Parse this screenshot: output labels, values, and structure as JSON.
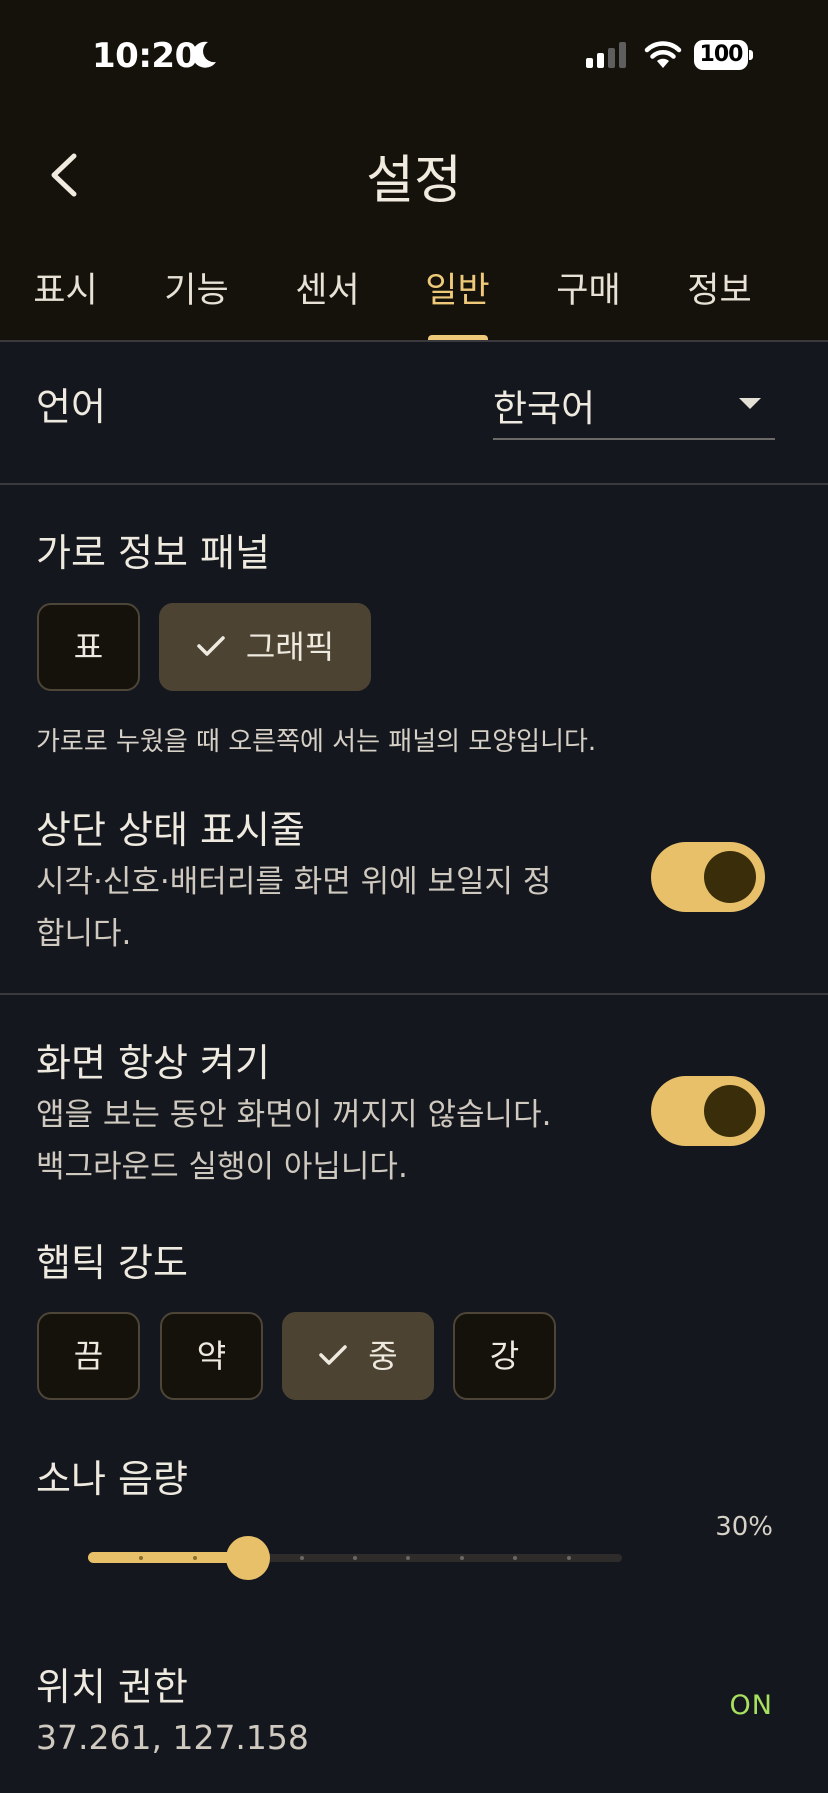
{
  "status_bar": {
    "time": "10:20",
    "battery": "100"
  },
  "header": {
    "title": "설정"
  },
  "tabs": [
    {
      "label": "표시"
    },
    {
      "label": "기능"
    },
    {
      "label": "센서"
    },
    {
      "label": "일반",
      "active": true
    },
    {
      "label": "구매"
    },
    {
      "label": "정보"
    }
  ],
  "language": {
    "label": "언어",
    "value": "한국어"
  },
  "landscape_panel": {
    "label": "가로 정보 패널",
    "options": [
      "표",
      "그래픽"
    ],
    "selected": "그래픽",
    "description": "가로로 누웠을 때 오른쪽에 서는 패널의 모양입니다."
  },
  "status_bar_setting": {
    "label": "상단 상태 표시줄",
    "description_line1": "시각·신호·배터리를 화면 위에 보일지 정",
    "description_line2": "합니다.",
    "enabled": true
  },
  "keep_screen_on": {
    "label": "화면 항상 켜기",
    "description_line1": "앱을 보는 동안 화면이 꺼지지 않습니다.",
    "description_line2": "백그라운드 실행이 아닙니다.",
    "enabled": true
  },
  "haptic": {
    "label": "햅틱 강도",
    "options": [
      "끔",
      "약",
      "중",
      "강"
    ],
    "selected": "중"
  },
  "sonar_volume": {
    "label": "소나 음량",
    "value_text": "30%",
    "value": 0.3
  },
  "location": {
    "label": "위치 권한",
    "coords": "37.261, 127.158",
    "status": "ON"
  },
  "colors": {
    "accent": "#efc97a",
    "toggle": "#e8c06a",
    "on": "#a8e060",
    "bg": "#14171d",
    "header_bg": "#15120c"
  }
}
